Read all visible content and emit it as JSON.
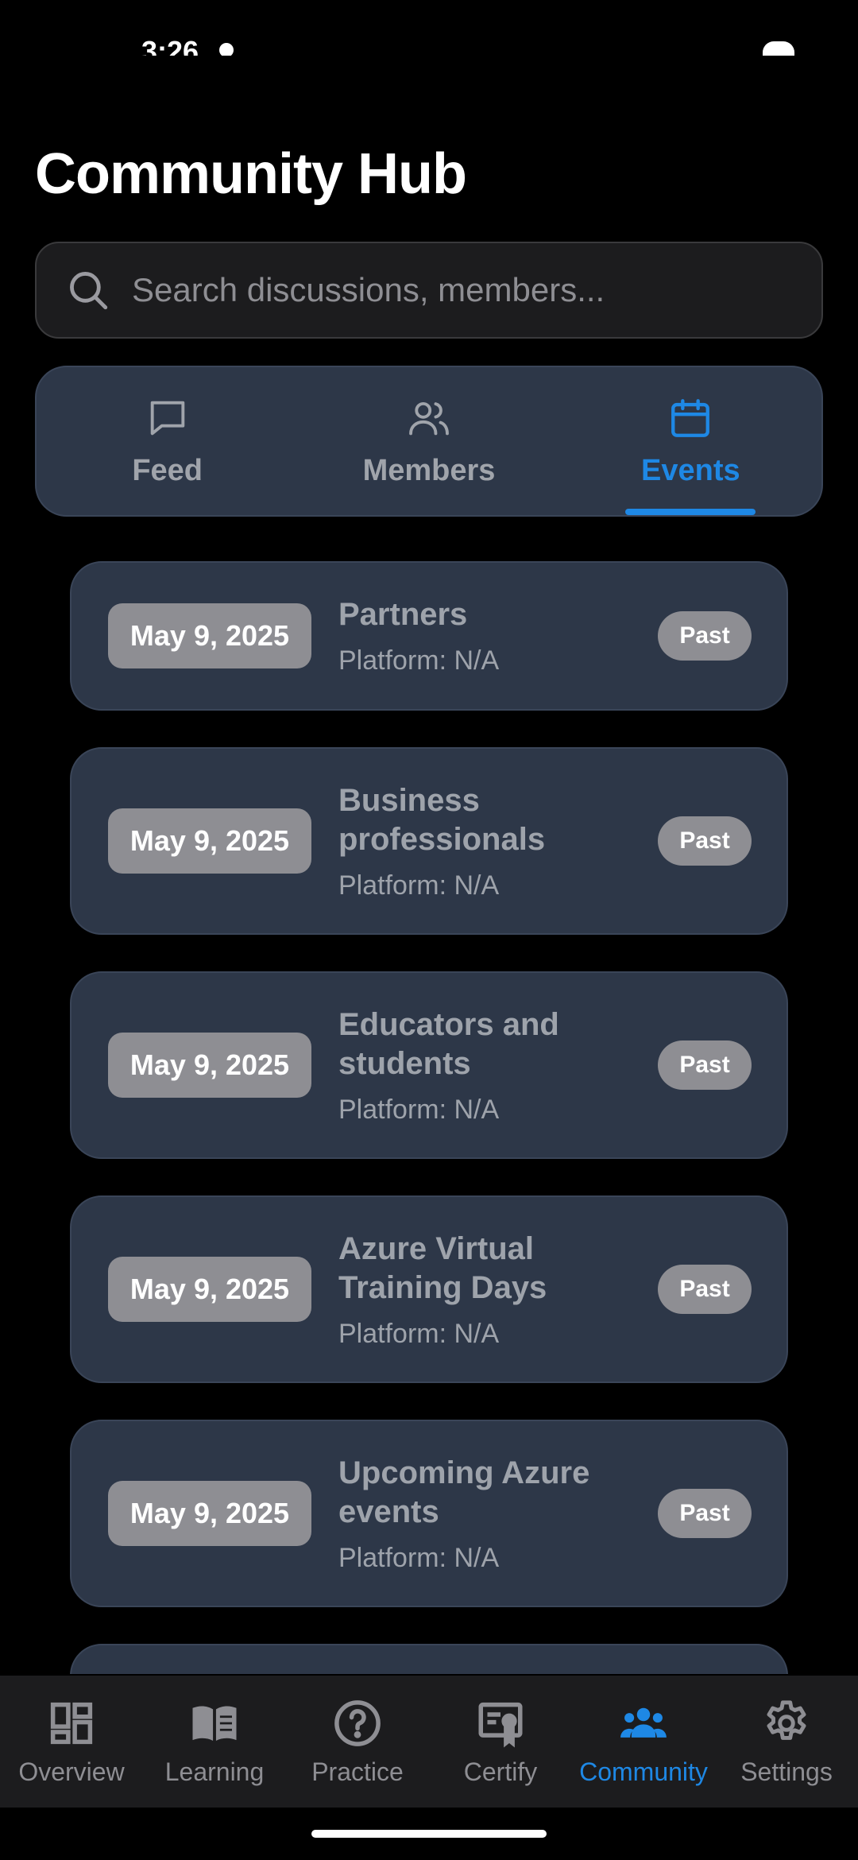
{
  "status": {
    "time": "3:26"
  },
  "page": {
    "title": "Community Hub"
  },
  "search": {
    "placeholder": "Search discussions, members..."
  },
  "tabs": [
    {
      "label": "Feed",
      "icon": "message-icon",
      "active": false
    },
    {
      "label": "Members",
      "icon": "users-icon",
      "active": false
    },
    {
      "label": "Events",
      "icon": "calendar-icon",
      "active": true
    }
  ],
  "events": [
    {
      "date": "May 9, 2025",
      "title": "Partners",
      "platform": "Platform: N/A",
      "status": "Past"
    },
    {
      "date": "May 9, 2025",
      "title": "Business professionals",
      "platform": "Platform: N/A",
      "status": "Past"
    },
    {
      "date": "May 9, 2025",
      "title": "Educators and students",
      "platform": "Platform: N/A",
      "status": "Past"
    },
    {
      "date": "May 9, 2025",
      "title": "Azure Virtual Training Days",
      "platform": "Platform: N/A",
      "status": "Past"
    },
    {
      "date": "May 9, 2025",
      "title": "Upcoming Azure events",
      "platform": "Platform: N/A",
      "status": "Past"
    }
  ],
  "bottom_nav": [
    {
      "label": "Overview",
      "icon": "dashboard-icon",
      "active": false
    },
    {
      "label": "Learning",
      "icon": "book-icon",
      "active": false
    },
    {
      "label": "Practice",
      "icon": "question-icon",
      "active": false
    },
    {
      "label": "Certify",
      "icon": "certificate-icon",
      "active": false
    },
    {
      "label": "Community",
      "icon": "people-icon",
      "active": true
    },
    {
      "label": "Settings",
      "icon": "gear-icon",
      "active": false
    }
  ],
  "colors": {
    "accent": "#1e88e5",
    "card": "#2d3748",
    "muted": "#8e8e93"
  }
}
